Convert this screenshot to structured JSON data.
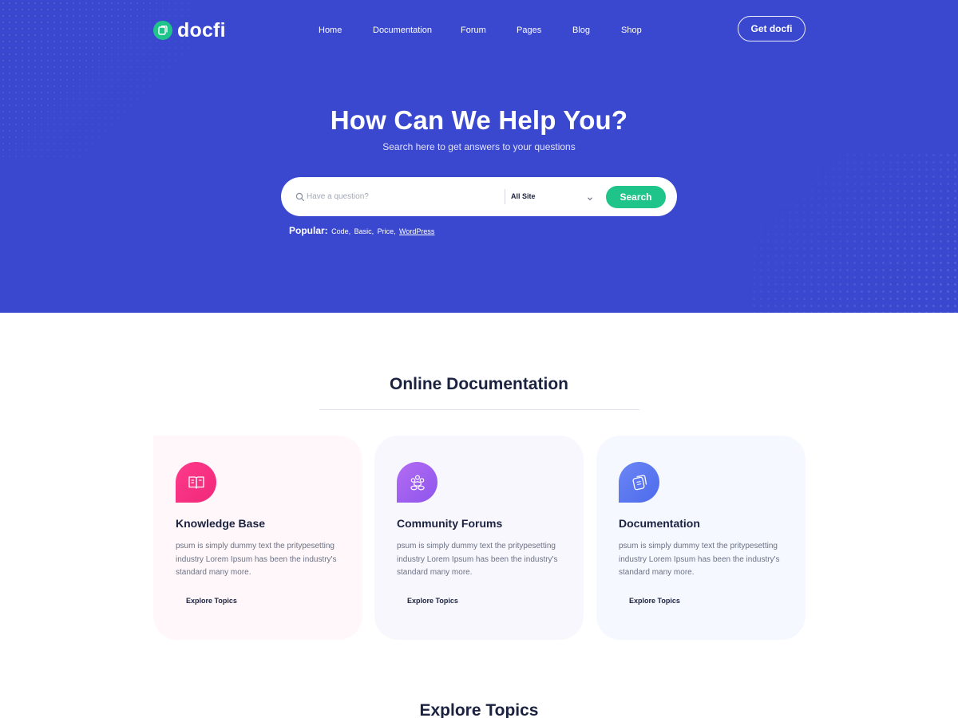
{
  "header": {
    "brand": "docfi",
    "nav": [
      "Home",
      "Documentation",
      "Forum",
      "Pages",
      "Blog",
      "Shop"
    ],
    "cta_label": "Get docfi"
  },
  "hero": {
    "title": "How Can We Help You?",
    "subtitle": "Search here to get answers to your questions",
    "search": {
      "placeholder": "Have a question?",
      "scope_selected": "All Site",
      "button_label": "Search"
    },
    "popular": {
      "label": "Popular:",
      "items": [
        "Code,",
        "Basic,",
        "Price,"
      ],
      "link": "WordPress"
    }
  },
  "documentation": {
    "title": "Online Documentation",
    "cards": [
      {
        "title": "Knowledge Base",
        "description": "psum is simply dummy text the pritypesetting industry Lorem Ipsum has been the industry's standard many more.",
        "link": "Explore Topics",
        "icon": "book-icon"
      },
      {
        "title": "Community Forums",
        "description": "psum is simply dummy text the pritypesetting industry Lorem Ipsum has been the industry's standard many more.",
        "link": "Explore Topics",
        "icon": "community-icon"
      },
      {
        "title": "Documentation",
        "description": "psum is simply dummy text the pritypesetting industry Lorem Ipsum has been the industry's standard many more.",
        "link": "Explore Topics",
        "icon": "docs-icon"
      }
    ]
  },
  "explore": {
    "title": "Explore Topics"
  },
  "colors": {
    "hero_bg": "#3a48d0",
    "accent_green": "#1fc48a",
    "pink": "#f0287a",
    "purple": "#8e55ec",
    "blue": "#4d6bec",
    "heading": "#1b2240"
  }
}
